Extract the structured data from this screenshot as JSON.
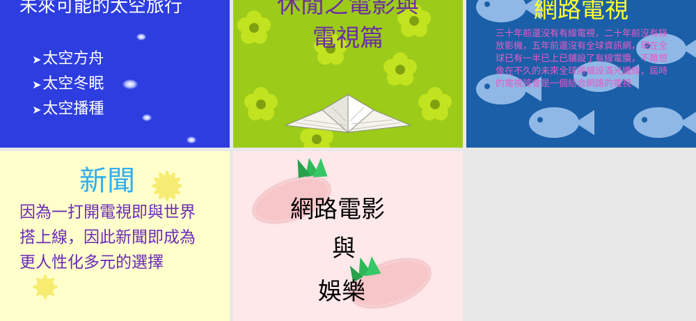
{
  "slides": {
    "space": {
      "title": "未來可能的太空旅行",
      "bullet_glyph": "➤",
      "items": [
        "太空方舟",
        "太空冬眠",
        "太空播種"
      ]
    },
    "leisure": {
      "title_line1": "休閒之電影與",
      "title_line2": "電視篇"
    },
    "network_tv": {
      "title": "網路電視",
      "body": "三十年前還沒有有線電視，二十年前沒有錄放影機，五年前還沒有全球資訊網，現在全球已有一半已上已鋪設了有線電纜，不難想像在不久的未來全球將鋪設滿光纖線，屆時的電視將會是一個結合網路的電視"
    },
    "news": {
      "title": "新聞",
      "body": "因為一打開電視即與世界搭上線，因此新聞即成為更人性化多元的選擇"
    },
    "entertainment": {
      "line1": "網路電影",
      "line2": "與",
      "line3": "娛樂"
    },
    "empty": {}
  },
  "colors": {
    "space_bg": "#2d3de0",
    "leisure_bg": "#9ccb1a",
    "network_bg": "#1a5fa8",
    "news_bg": "#ffffcc",
    "entertainment_bg": "#ffe8ea",
    "empty_bg": "#e8e8e8"
  },
  "icons": [
    "star-icon",
    "flower-icon",
    "paper-hat-icon",
    "fish-icon",
    "sun-icon",
    "carrot-icon"
  ]
}
